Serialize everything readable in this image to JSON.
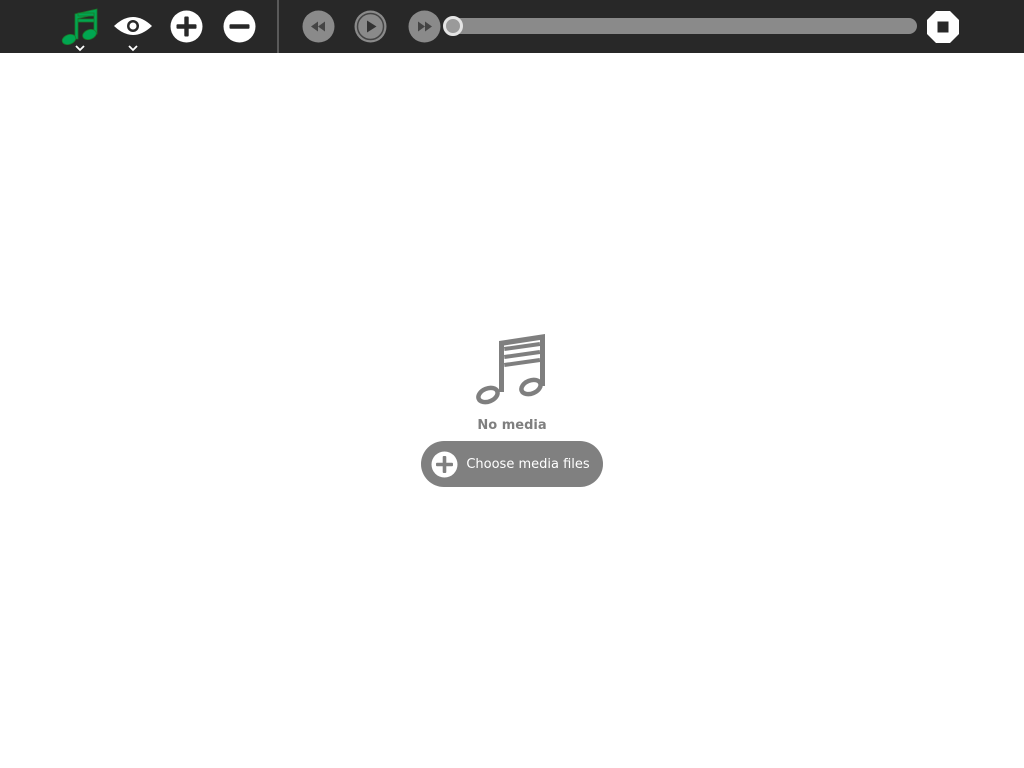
{
  "toolbar": {
    "buttons": [
      {
        "name": "music-note-icon",
        "role": "media-library-menu",
        "color": "#00a651",
        "has_dropdown": true
      },
      {
        "name": "eye-icon",
        "role": "view-menu",
        "has_dropdown": true
      },
      {
        "name": "plus-circle-icon",
        "role": "add-media"
      },
      {
        "name": "minus-circle-icon",
        "role": "remove-media"
      },
      {
        "name": "rewind-icon",
        "role": "previous"
      },
      {
        "name": "play-icon",
        "role": "play"
      },
      {
        "name": "fast-forward-icon",
        "role": "next"
      },
      {
        "name": "stop-icon",
        "role": "stop"
      }
    ],
    "progress": {
      "fraction": 0.0
    }
  },
  "empty_state": {
    "icon": "music-note-icon",
    "title": "No media",
    "button_label": "Choose media files",
    "button_icon": "plus-circle-icon"
  },
  "colors": {
    "toolbar_bg": "#282828",
    "accent_green": "#00a651",
    "muted_gray": "#808080",
    "background": "#ffffff"
  }
}
